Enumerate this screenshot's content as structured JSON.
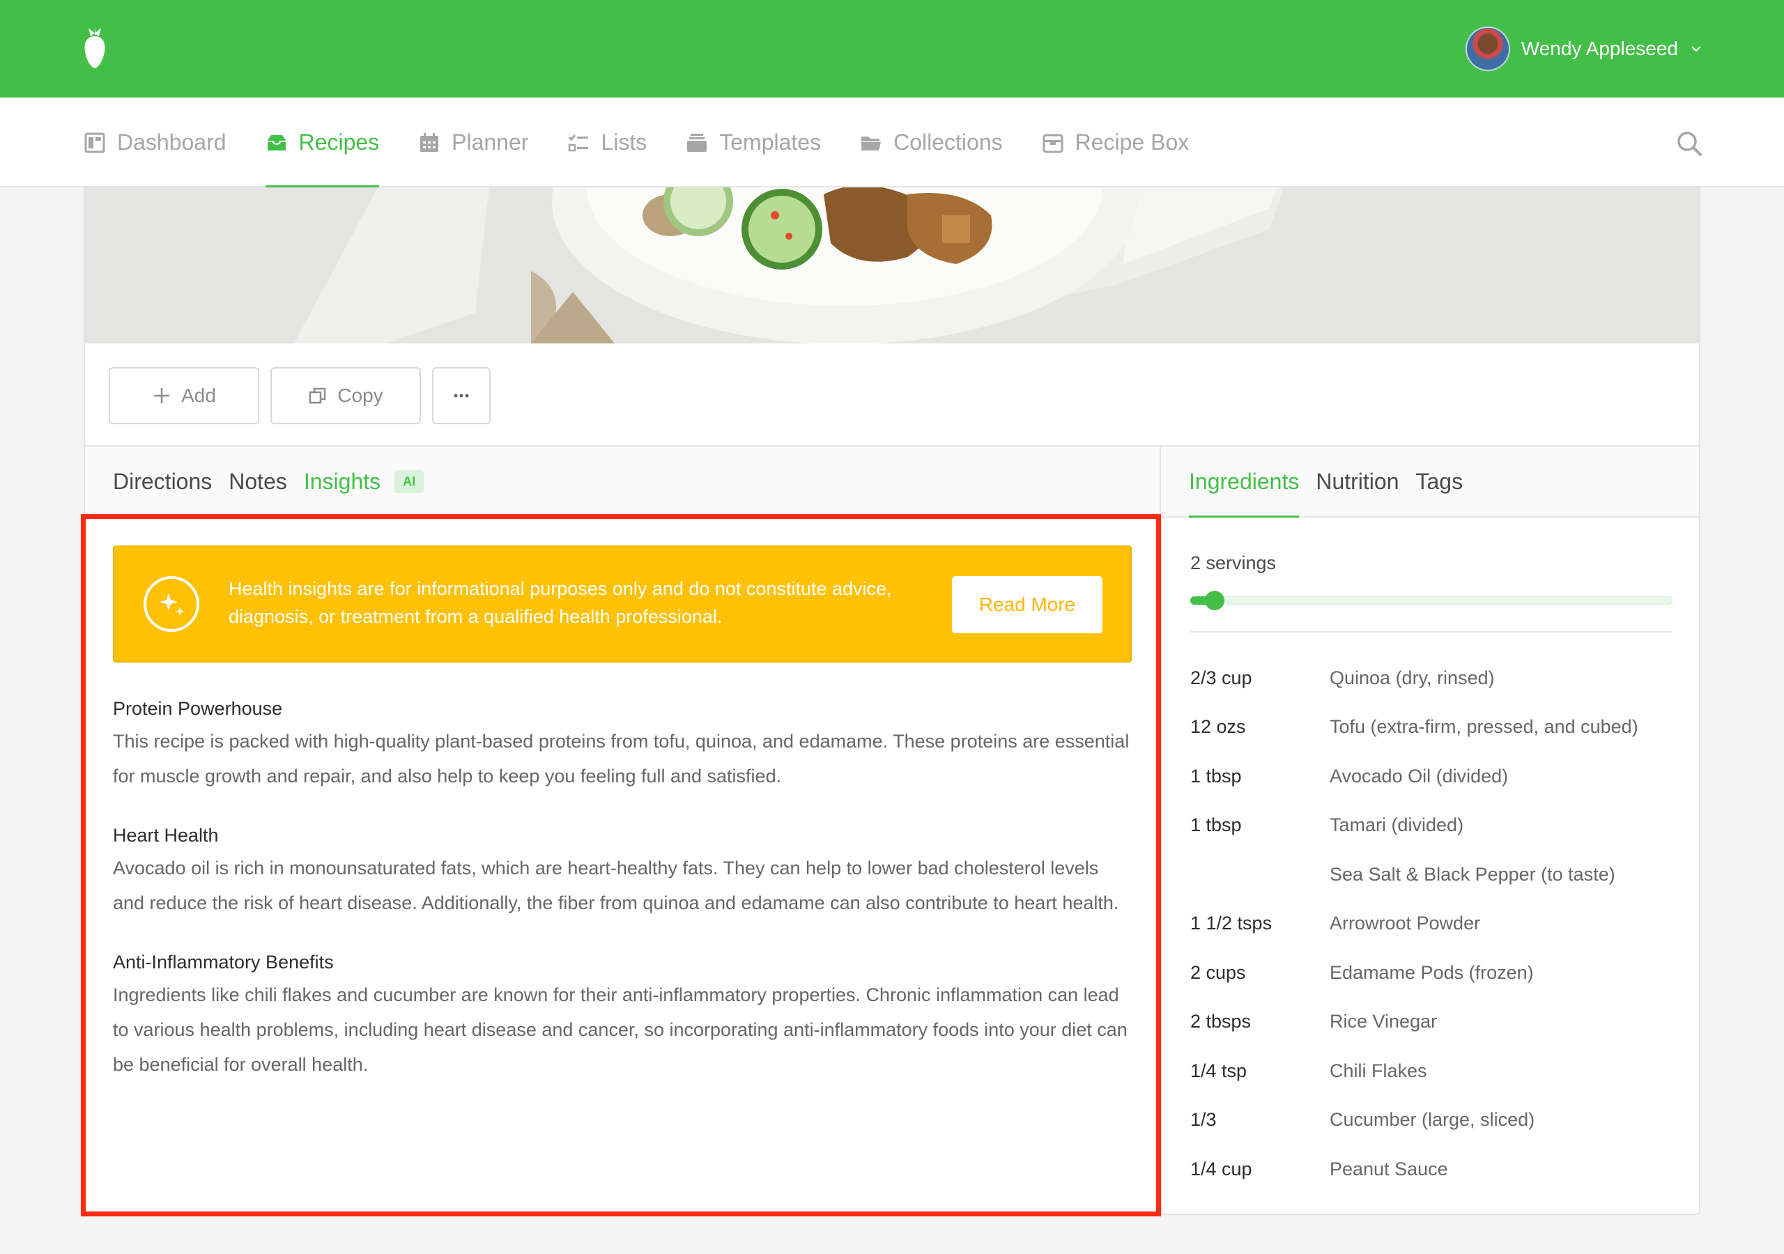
{
  "user": {
    "name": "Wendy Appleseed"
  },
  "nav": {
    "items": [
      {
        "label": "Dashboard",
        "icon": "dashboard-icon",
        "active": false
      },
      {
        "label": "Recipes",
        "icon": "recipes-icon",
        "active": true
      },
      {
        "label": "Planner",
        "icon": "calendar-icon",
        "active": false
      },
      {
        "label": "Lists",
        "icon": "list-icon",
        "active": false
      },
      {
        "label": "Templates",
        "icon": "templates-icon",
        "active": false
      },
      {
        "label": "Collections",
        "icon": "folder-icon",
        "active": false
      },
      {
        "label": "Recipe Box",
        "icon": "box-icon",
        "active": false
      }
    ]
  },
  "actions": {
    "add": "Add",
    "copy": "Copy"
  },
  "left_tabs": {
    "directions": "Directions",
    "notes": "Notes",
    "insights": "Insights",
    "ai_badge": "AI",
    "active": "Insights"
  },
  "right_tabs": {
    "ingredients": "Ingredients",
    "nutrition": "Nutrition",
    "tags": "Tags",
    "active": "Ingredients"
  },
  "banner": {
    "text": "Health insights are for informational purposes only and do not constitute advice, diagnosis, or treatment from a qualified health professional.",
    "button": "Read More"
  },
  "insights": [
    {
      "title": "Protein Powerhouse",
      "body": "This recipe is packed with high-quality plant-based proteins from tofu, quinoa, and edamame. These proteins are essential for muscle growth and repair, and also help to keep you feeling full and satisfied."
    },
    {
      "title": "Heart Health",
      "body": "Avocado oil is rich in monounsaturated fats, which are heart-healthy fats. They can help to lower bad cholesterol levels and reduce the risk of heart disease. Additionally, the fiber from quinoa and edamame can also contribute to heart health."
    },
    {
      "title": "Anti-Inflammatory Benefits",
      "body": "Ingredients like chili flakes and cucumber are known for their anti-inflammatory properties. Chronic inflammation can lead to various health problems, including heart disease and cancer, so incorporating anti-inflammatory foods into your diet can be beneficial for overall health."
    }
  ],
  "servings": {
    "label": "2 servings",
    "slider_fraction": 0.05
  },
  "ingredients": [
    {
      "qty": "2/3 cup",
      "name": "Quinoa (dry, rinsed)"
    },
    {
      "qty": "12 ozs",
      "name": "Tofu (extra-firm, pressed, and cubed)"
    },
    {
      "qty": "1 tbsp",
      "name": "Avocado Oil (divided)"
    },
    {
      "qty": "1 tbsp",
      "name": "Tamari (divided)"
    },
    {
      "qty": "",
      "name": "Sea Salt & Black Pepper (to taste)"
    },
    {
      "qty": "1 1/2 tsps",
      "name": "Arrowroot Powder"
    },
    {
      "qty": "2 cups",
      "name": "Edamame Pods (frozen)"
    },
    {
      "qty": "2 tbsps",
      "name": "Rice Vinegar"
    },
    {
      "qty": "1/4 tsp",
      "name": "Chili Flakes"
    },
    {
      "qty": "1/3",
      "name": "Cucumber (large, sliced)"
    },
    {
      "qty": "1/4 cup",
      "name": "Peanut Sauce"
    }
  ],
  "colors": {
    "brand": "#43bf48",
    "warning": "#ffc105",
    "highlight": "#ff2a14"
  }
}
